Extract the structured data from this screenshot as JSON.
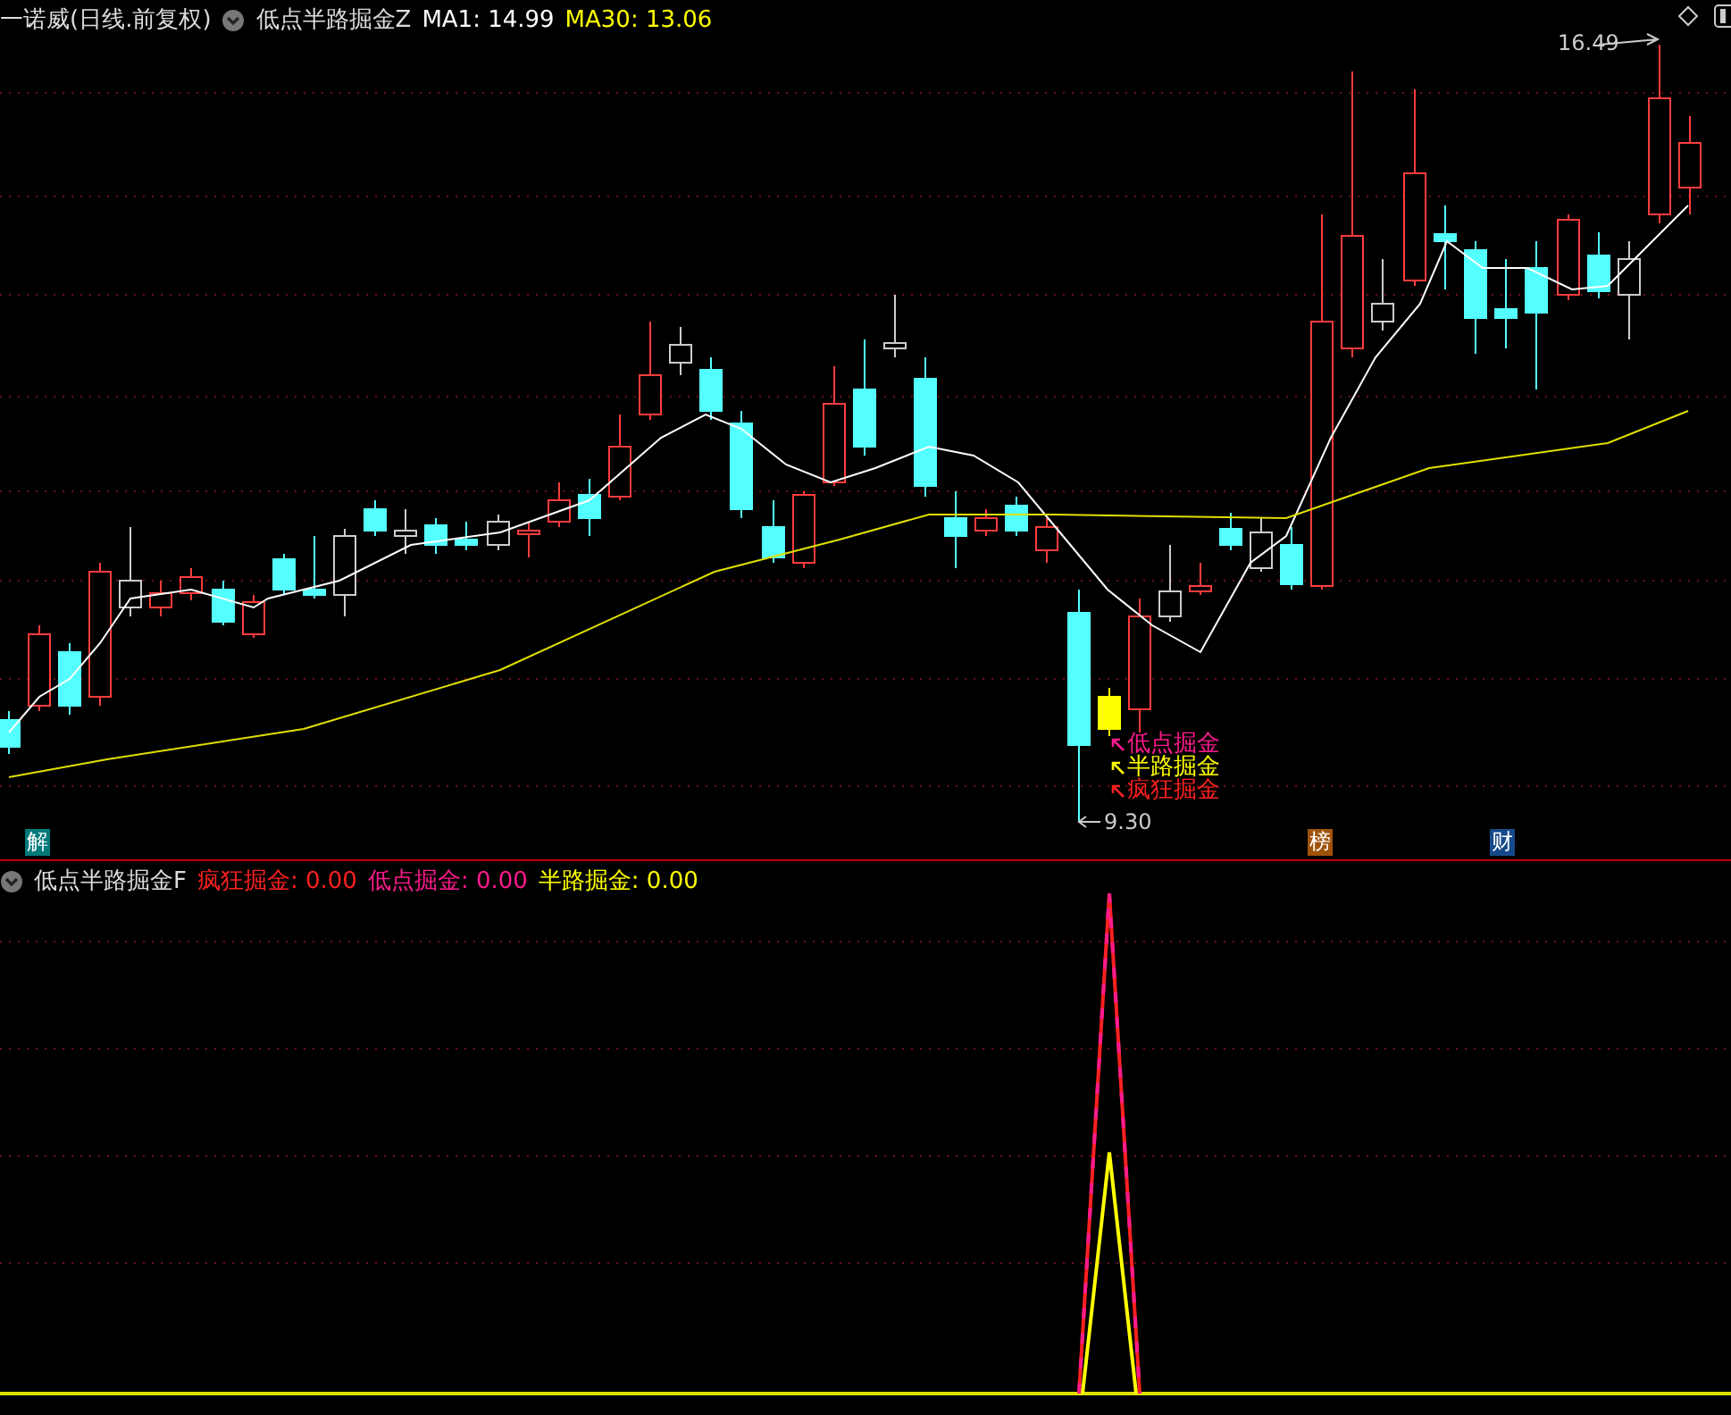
{
  "header": {
    "title": "一诺威(日线.前复权)",
    "indicator": "低点半路掘金Z",
    "readings": [
      {
        "text": "MA1: 14.99",
        "color": "#ffffff"
      },
      {
        "text": "MA30: 13.06",
        "color": "#ffff00"
      }
    ]
  },
  "main_chart": {
    "high_label": "16.49",
    "low_label": "9.30",
    "signals": [
      {
        "text": "低点掘金",
        "color": "#ff1a8c"
      },
      {
        "text": "半路掘金",
        "color": "#ffff00"
      },
      {
        "text": "疯狂掘金",
        "color": "#ff2020"
      }
    ],
    "badges": [
      {
        "text": "解",
        "color": "#007a7a"
      },
      {
        "text": "榜",
        "color": "#a0520a"
      },
      {
        "text": "财",
        "color": "#154a8a"
      }
    ]
  },
  "sub_chart": {
    "indicator": "低点半路掘金F",
    "readings": [
      {
        "text": "疯狂掘金: 0.00",
        "color": "#ff2020"
      },
      {
        "text": "低点掘金: 0.00",
        "color": "#ff1a8c"
      },
      {
        "text": "半路掘金: 0.00",
        "color": "#ffff00"
      }
    ]
  }
}
